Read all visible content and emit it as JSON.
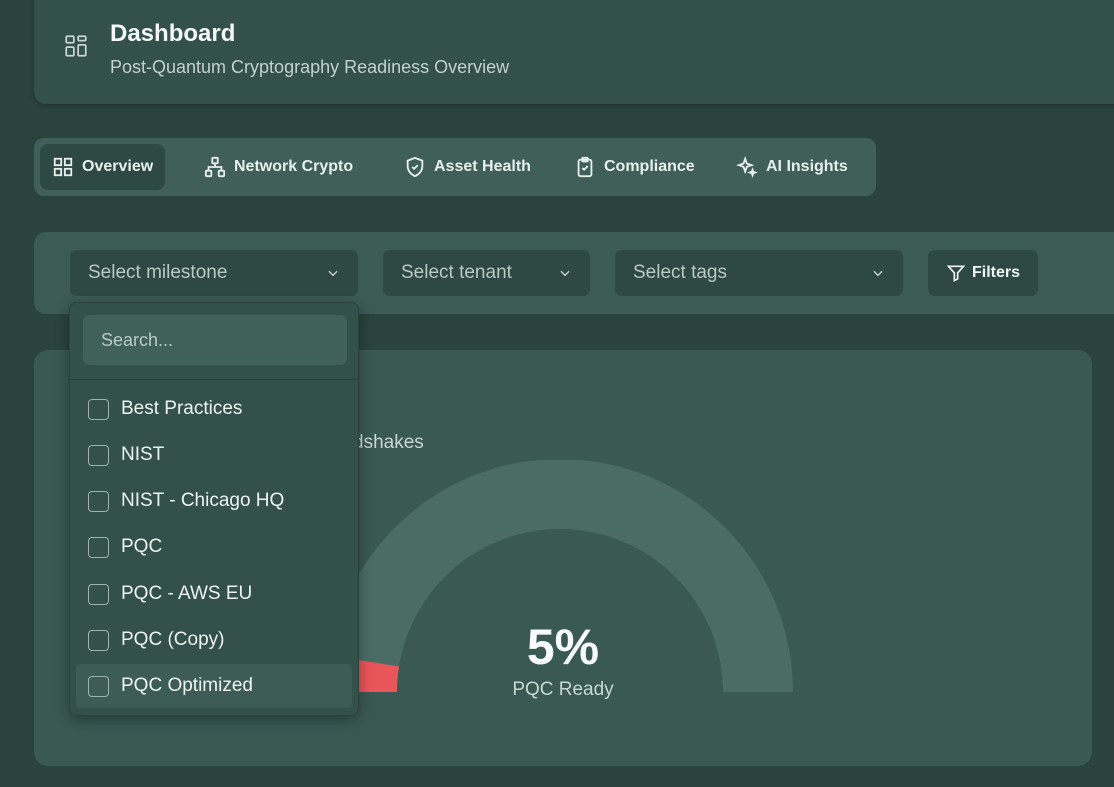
{
  "header": {
    "title": "Dashboard",
    "subtitle": "Post-Quantum Cryptography Readiness Overview"
  },
  "tabs": [
    {
      "label": "Overview",
      "icon": "grid-icon",
      "active": true
    },
    {
      "label": "Network Crypto",
      "icon": "network-icon",
      "active": false
    },
    {
      "label": "Asset Health",
      "icon": "shield-icon",
      "active": false
    },
    {
      "label": "Compliance",
      "icon": "clipboard-icon",
      "active": false
    },
    {
      "label": "AI Insights",
      "icon": "sparkles-icon",
      "active": false
    }
  ],
  "filters": {
    "milestone_placeholder": "Select milestone",
    "tenant_placeholder": "Select tenant",
    "tags_placeholder": "Select tags",
    "filters_label": "Filters"
  },
  "dropdown": {
    "search_placeholder": "Search...",
    "options": [
      "Best Practices",
      "NIST",
      "NIST - Chicago HQ",
      "PQC",
      "PQC - AWS EU",
      "PQC (Copy)",
      "PQC Optimized"
    ]
  },
  "gauge": {
    "partial_text": "dshakes",
    "value_text": "5%",
    "value": 5,
    "label": "PQC Ready",
    "fill_color": "#e8555a",
    "track_color": "#4a6c65"
  },
  "colors": {
    "background": "#2b433d",
    "card": "#33504a",
    "accent_red": "#e8555a"
  }
}
